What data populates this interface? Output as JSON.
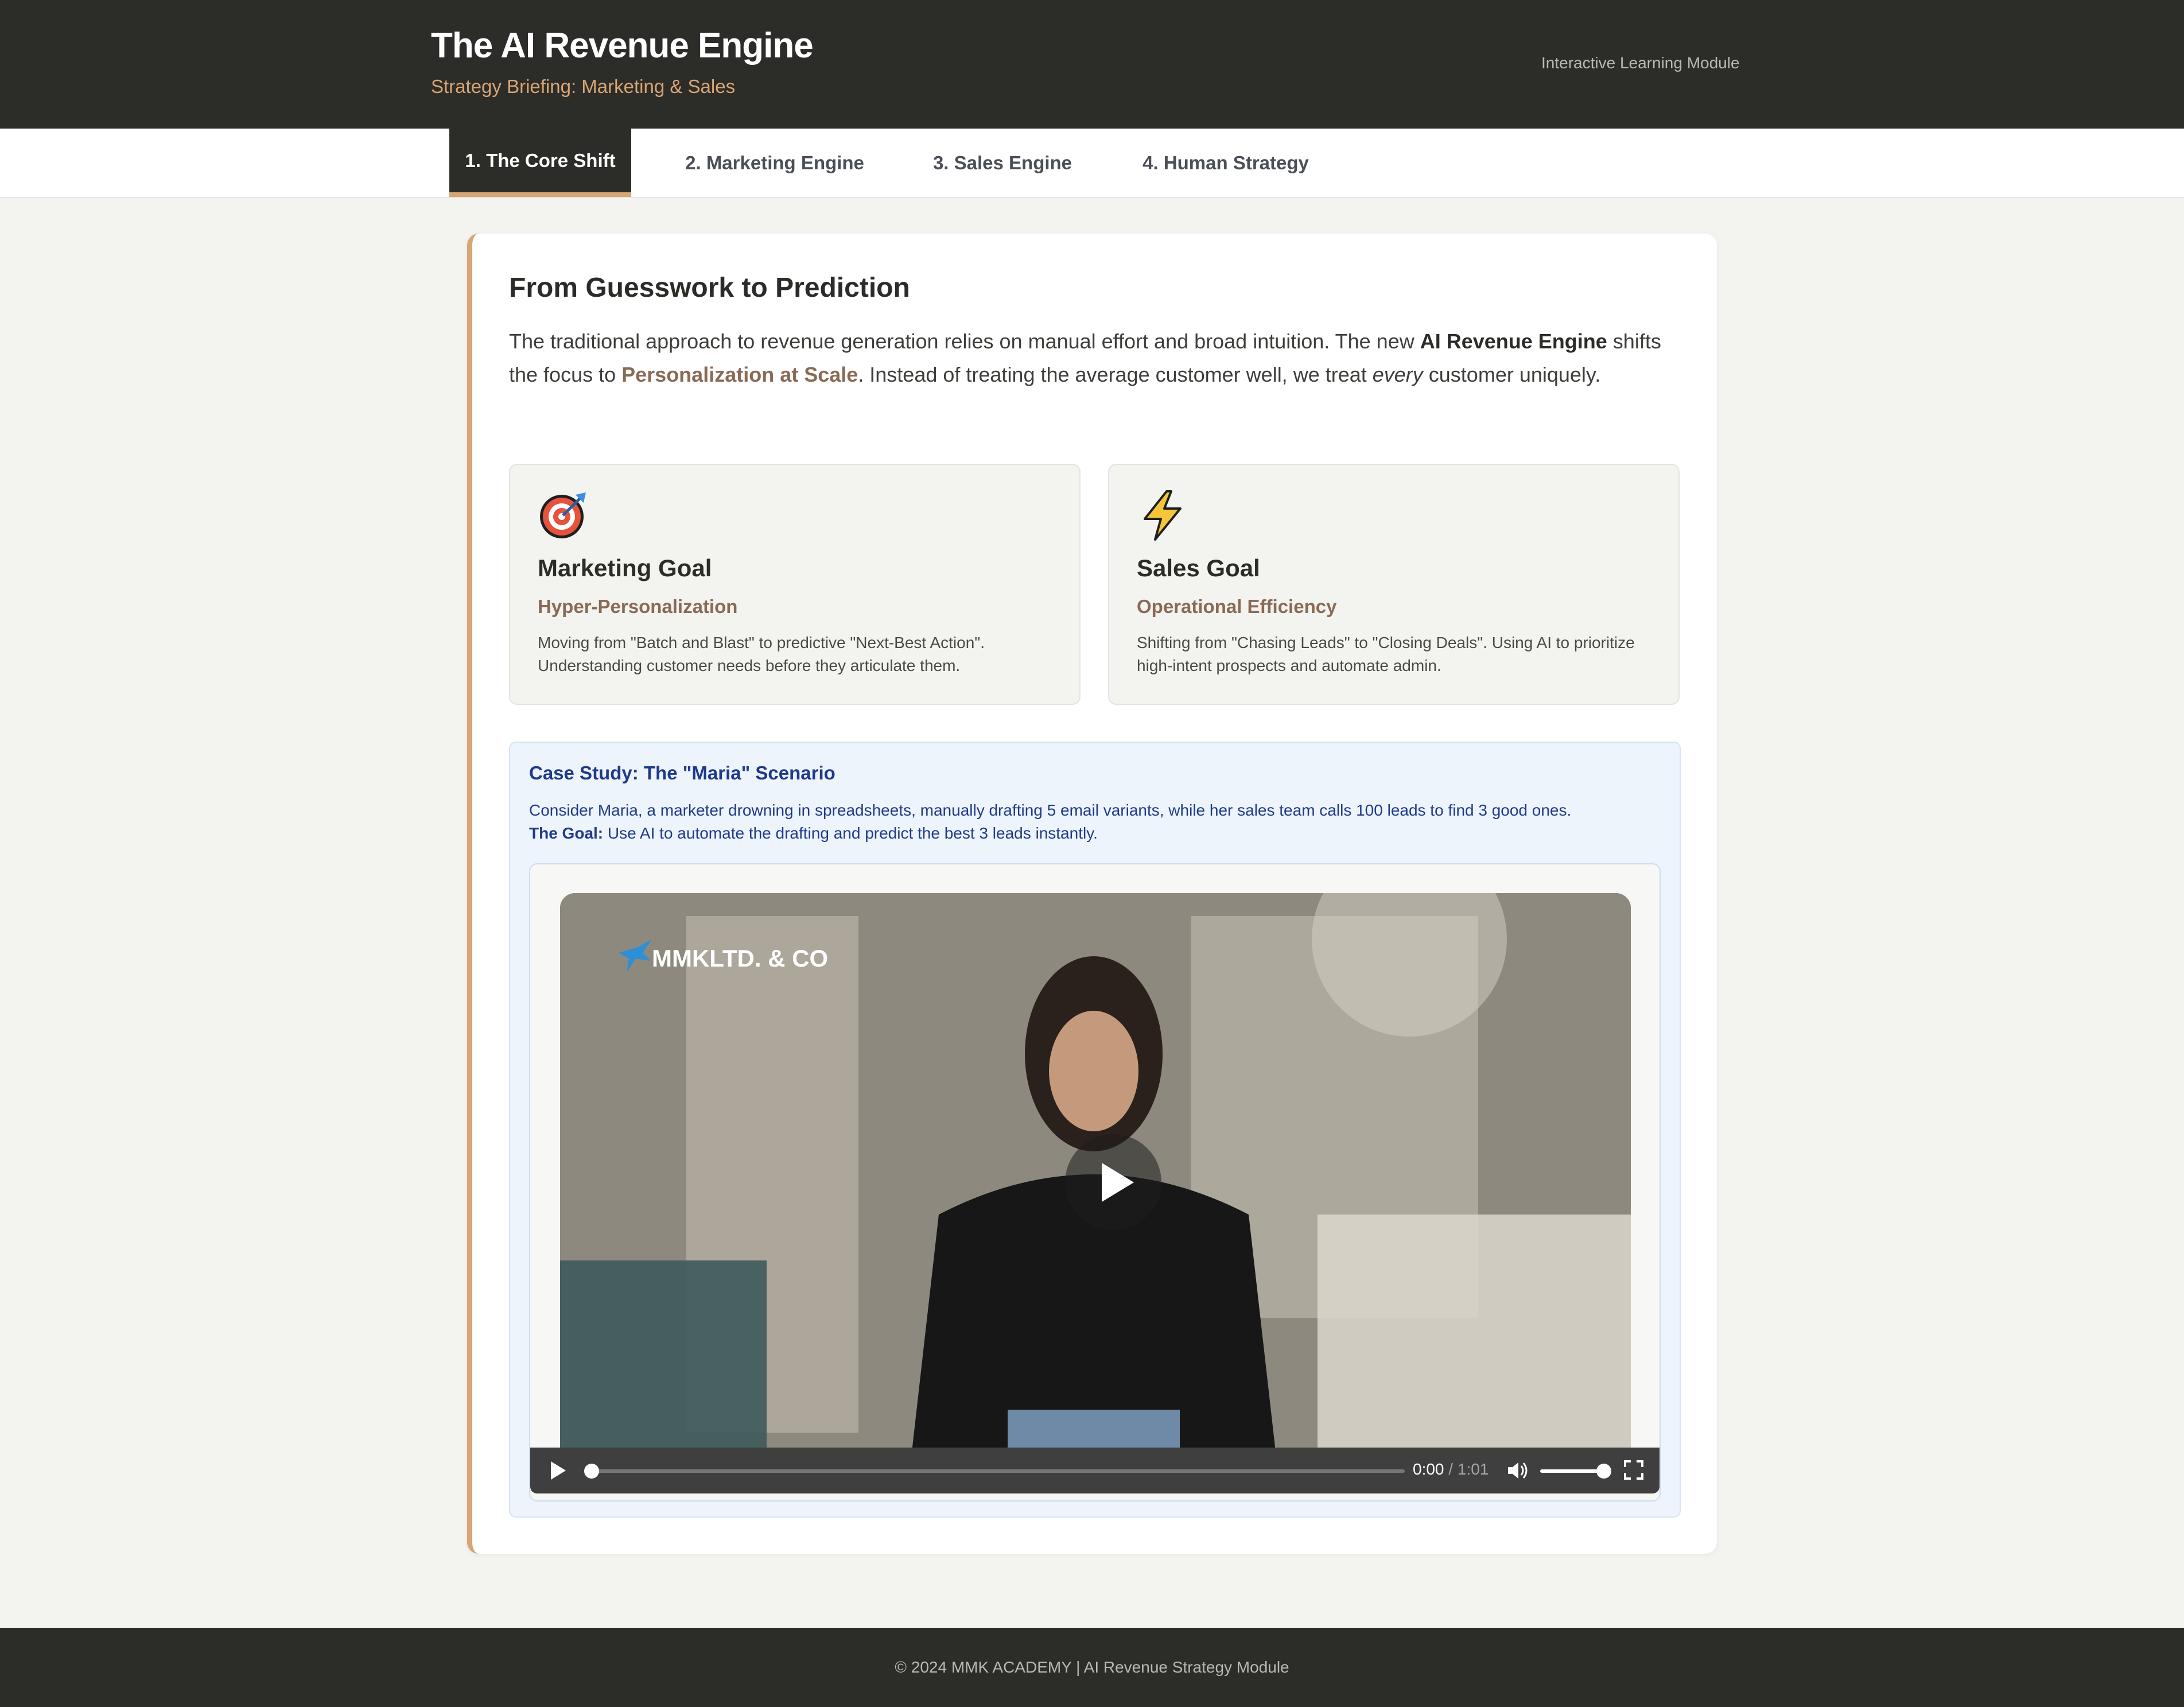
{
  "header": {
    "title": "The AI Revenue Engine",
    "subtitle": "Strategy Briefing: Marketing & Sales",
    "module_label": "Interactive Learning Module"
  },
  "tabs": [
    {
      "label": "1. The Core Shift",
      "active": true
    },
    {
      "label": "2. Marketing Engine",
      "active": false
    },
    {
      "label": "3. Sales Engine",
      "active": false
    },
    {
      "label": "4. Human Strategy",
      "active": false
    }
  ],
  "section": {
    "title": "From Guesswork to Prediction",
    "intro_part1": "The traditional approach to revenue generation relies on manual effort and broad intuition. The new ",
    "intro_bold": "AI Revenue Engine",
    "intro_part2": " shifts the focus to ",
    "intro_accent": "Personalization at Scale",
    "intro_part3": ". Instead of treating the average customer well, we treat ",
    "intro_em": "every",
    "intro_part4": " customer uniquely."
  },
  "goals": [
    {
      "icon": "target-icon",
      "title": "Marketing Goal",
      "subtitle": "Hyper-Personalization",
      "description": "Moving from \"Batch and Blast\" to predictive \"Next-Best Action\". Understanding customer needs before they articulate them."
    },
    {
      "icon": "lightning-icon",
      "title": "Sales Goal",
      "subtitle": "Operational Efficiency",
      "description": "Shifting from \"Chasing Leads\" to \"Closing Deals\". Using AI to prioritize high-intent prospects and automate admin."
    }
  ],
  "case_study": {
    "title": "Case Study: The \"Maria\" Scenario",
    "text": "Consider Maria, a marketer drowning in spreadsheets, manually drafting 5 email variants, while her sales team calls 100 leads to find 3 good ones.",
    "goal_label": "The Goal:",
    "goal_text": " Use AI to automate the drafting and predict the best 3 leads instantly."
  },
  "video": {
    "logo_text": "MMKLTD. & CO",
    "current_time": "0:00",
    "separator": " / ",
    "duration": "1:01",
    "progress": 0.0,
    "volume": 1.0
  },
  "footer": {
    "text": "© 2024 MMK ACADEMY | AI Revenue Strategy Module"
  },
  "colors": {
    "header_bg": "#2c2c29",
    "accent": "#d8a574",
    "accent_text": "#8a6a55",
    "case_bg": "#eef4fc",
    "case_text": "#1f3a8a"
  }
}
